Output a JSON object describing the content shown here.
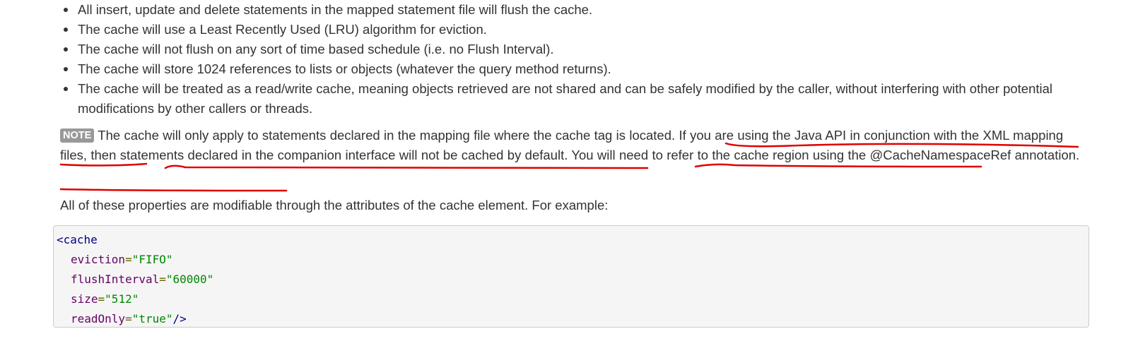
{
  "bullets": [
    "All insert, update and delete statements in the mapped statement file will flush the cache.",
    "The cache will use a Least Recently Used (LRU) algorithm for eviction.",
    "The cache will not flush on any sort of time based schedule (i.e. no Flush Interval).",
    "The cache will store 1024 references to lists or objects (whatever the query method returns).",
    "The cache will be treated as a read/write cache, meaning objects retrieved are not shared and can be safely modified by the caller, without interfering with other potential modifications by other callers or threads."
  ],
  "note": {
    "badge": "NOTE",
    "text": "The cache will only apply to statements declared in the mapping file where the cache tag is located. If you are using the Java API in conjunction with the XML mapping files, then statements declared in the companion interface will not be cached by default. You will need to refer to the cache region using the @CacheNamespaceRef annotation."
  },
  "intro": "All of these properties are modifiable through the attributes of the cache element. For example:",
  "code": {
    "open_tag": "<cache",
    "attrs": [
      {
        "name": "eviction",
        "value": "\"FIFO\""
      },
      {
        "name": "flushInterval",
        "value": "\"60000\""
      },
      {
        "name": "size",
        "value": "\"512\""
      },
      {
        "name": "readOnly",
        "value": "\"true\""
      }
    ],
    "close": "/>"
  },
  "colors": {
    "text": "#333333",
    "annotation": "#e00000",
    "code_tag": "#000088",
    "code_attr": "#660066",
    "code_string": "#008800"
  }
}
